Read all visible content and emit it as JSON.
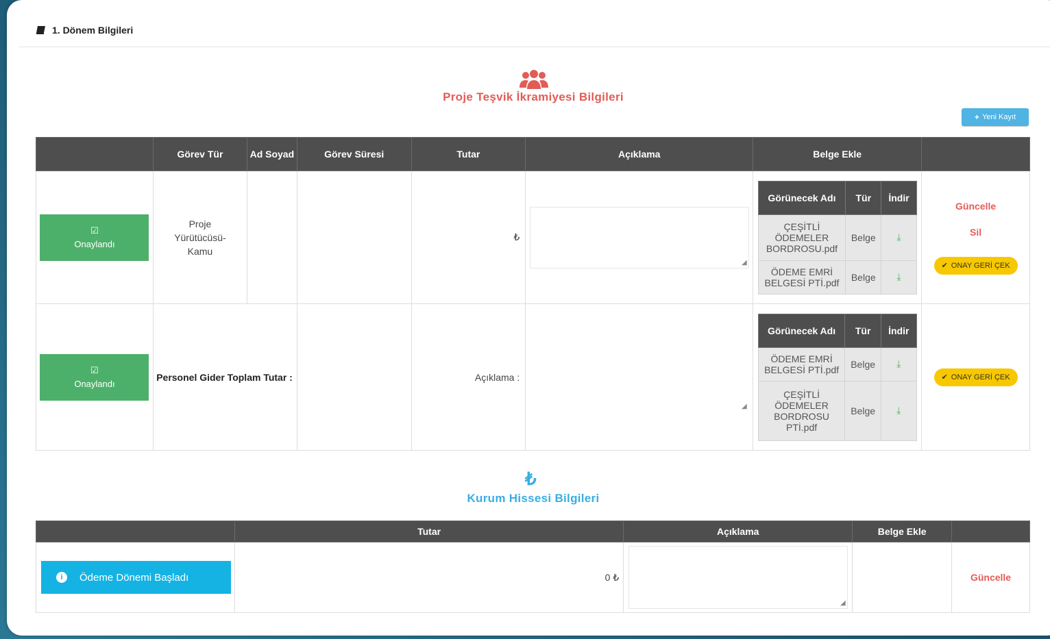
{
  "panel": {
    "title": "1. Dönem Bilgileri",
    "icon": "book-icon"
  },
  "section1": {
    "title": "Proje Teşvik İkramiyesi Bilgileri",
    "icon": "users-icon",
    "new_button": "Yeni Kayıt",
    "headers": [
      "",
      "Görev Tür",
      "Ad Soyad",
      "Görev Süresi",
      "Tutar",
      "Açıklama",
      "Belge Ekle",
      ""
    ],
    "doc_headers": [
      "Görünecek Adı",
      "Tür",
      "İndir"
    ],
    "rows": [
      {
        "status": "Onaylandı",
        "gorev_tur": "Proje Yürütücüsü-Kamu",
        "ad_soyad": "",
        "gorev_suresi": "",
        "tutar": "₺",
        "aciklama": "",
        "docs": [
          {
            "name": "ÇEŞİTLİ ÖDEMELER BORDROSU.pdf",
            "type": "Belge"
          },
          {
            "name": "ÖDEME EMRİ BELGESİ PTİ.pdf",
            "type": "Belge"
          }
        ],
        "actions": {
          "update": "Güncelle",
          "delete": "Sil",
          "revoke": "ONAY GERİ ÇEK"
        }
      },
      {
        "status": "Onaylandı",
        "total_label": "Personel Gider Toplam Tutar :",
        "aciklama_label": "Açıklama :",
        "docs": [
          {
            "name": "ÖDEME EMRİ BELGESİ PTİ.pdf",
            "type": "Belge"
          },
          {
            "name": "ÇEŞİTLİ ÖDEMELER BORDROSU PTİ.pdf",
            "type": "Belge"
          }
        ],
        "actions": {
          "revoke": "ONAY GERİ ÇEK"
        }
      }
    ]
  },
  "section2": {
    "title": "Kurum Hissesi Bilgileri",
    "icon": "lira-icon",
    "headers": [
      "",
      "Tutar",
      "Açıklama",
      "Belge Ekle",
      ""
    ],
    "row": {
      "status": "Ödeme Dönemi Başladı",
      "tutar": "0 ₺",
      "update": "Güncelle"
    }
  },
  "colors": {
    "red": "#e25c57",
    "green": "#4db06a",
    "blue": "#14b3e4",
    "yellow": "#f7c800",
    "header": "#4e4e4e"
  }
}
